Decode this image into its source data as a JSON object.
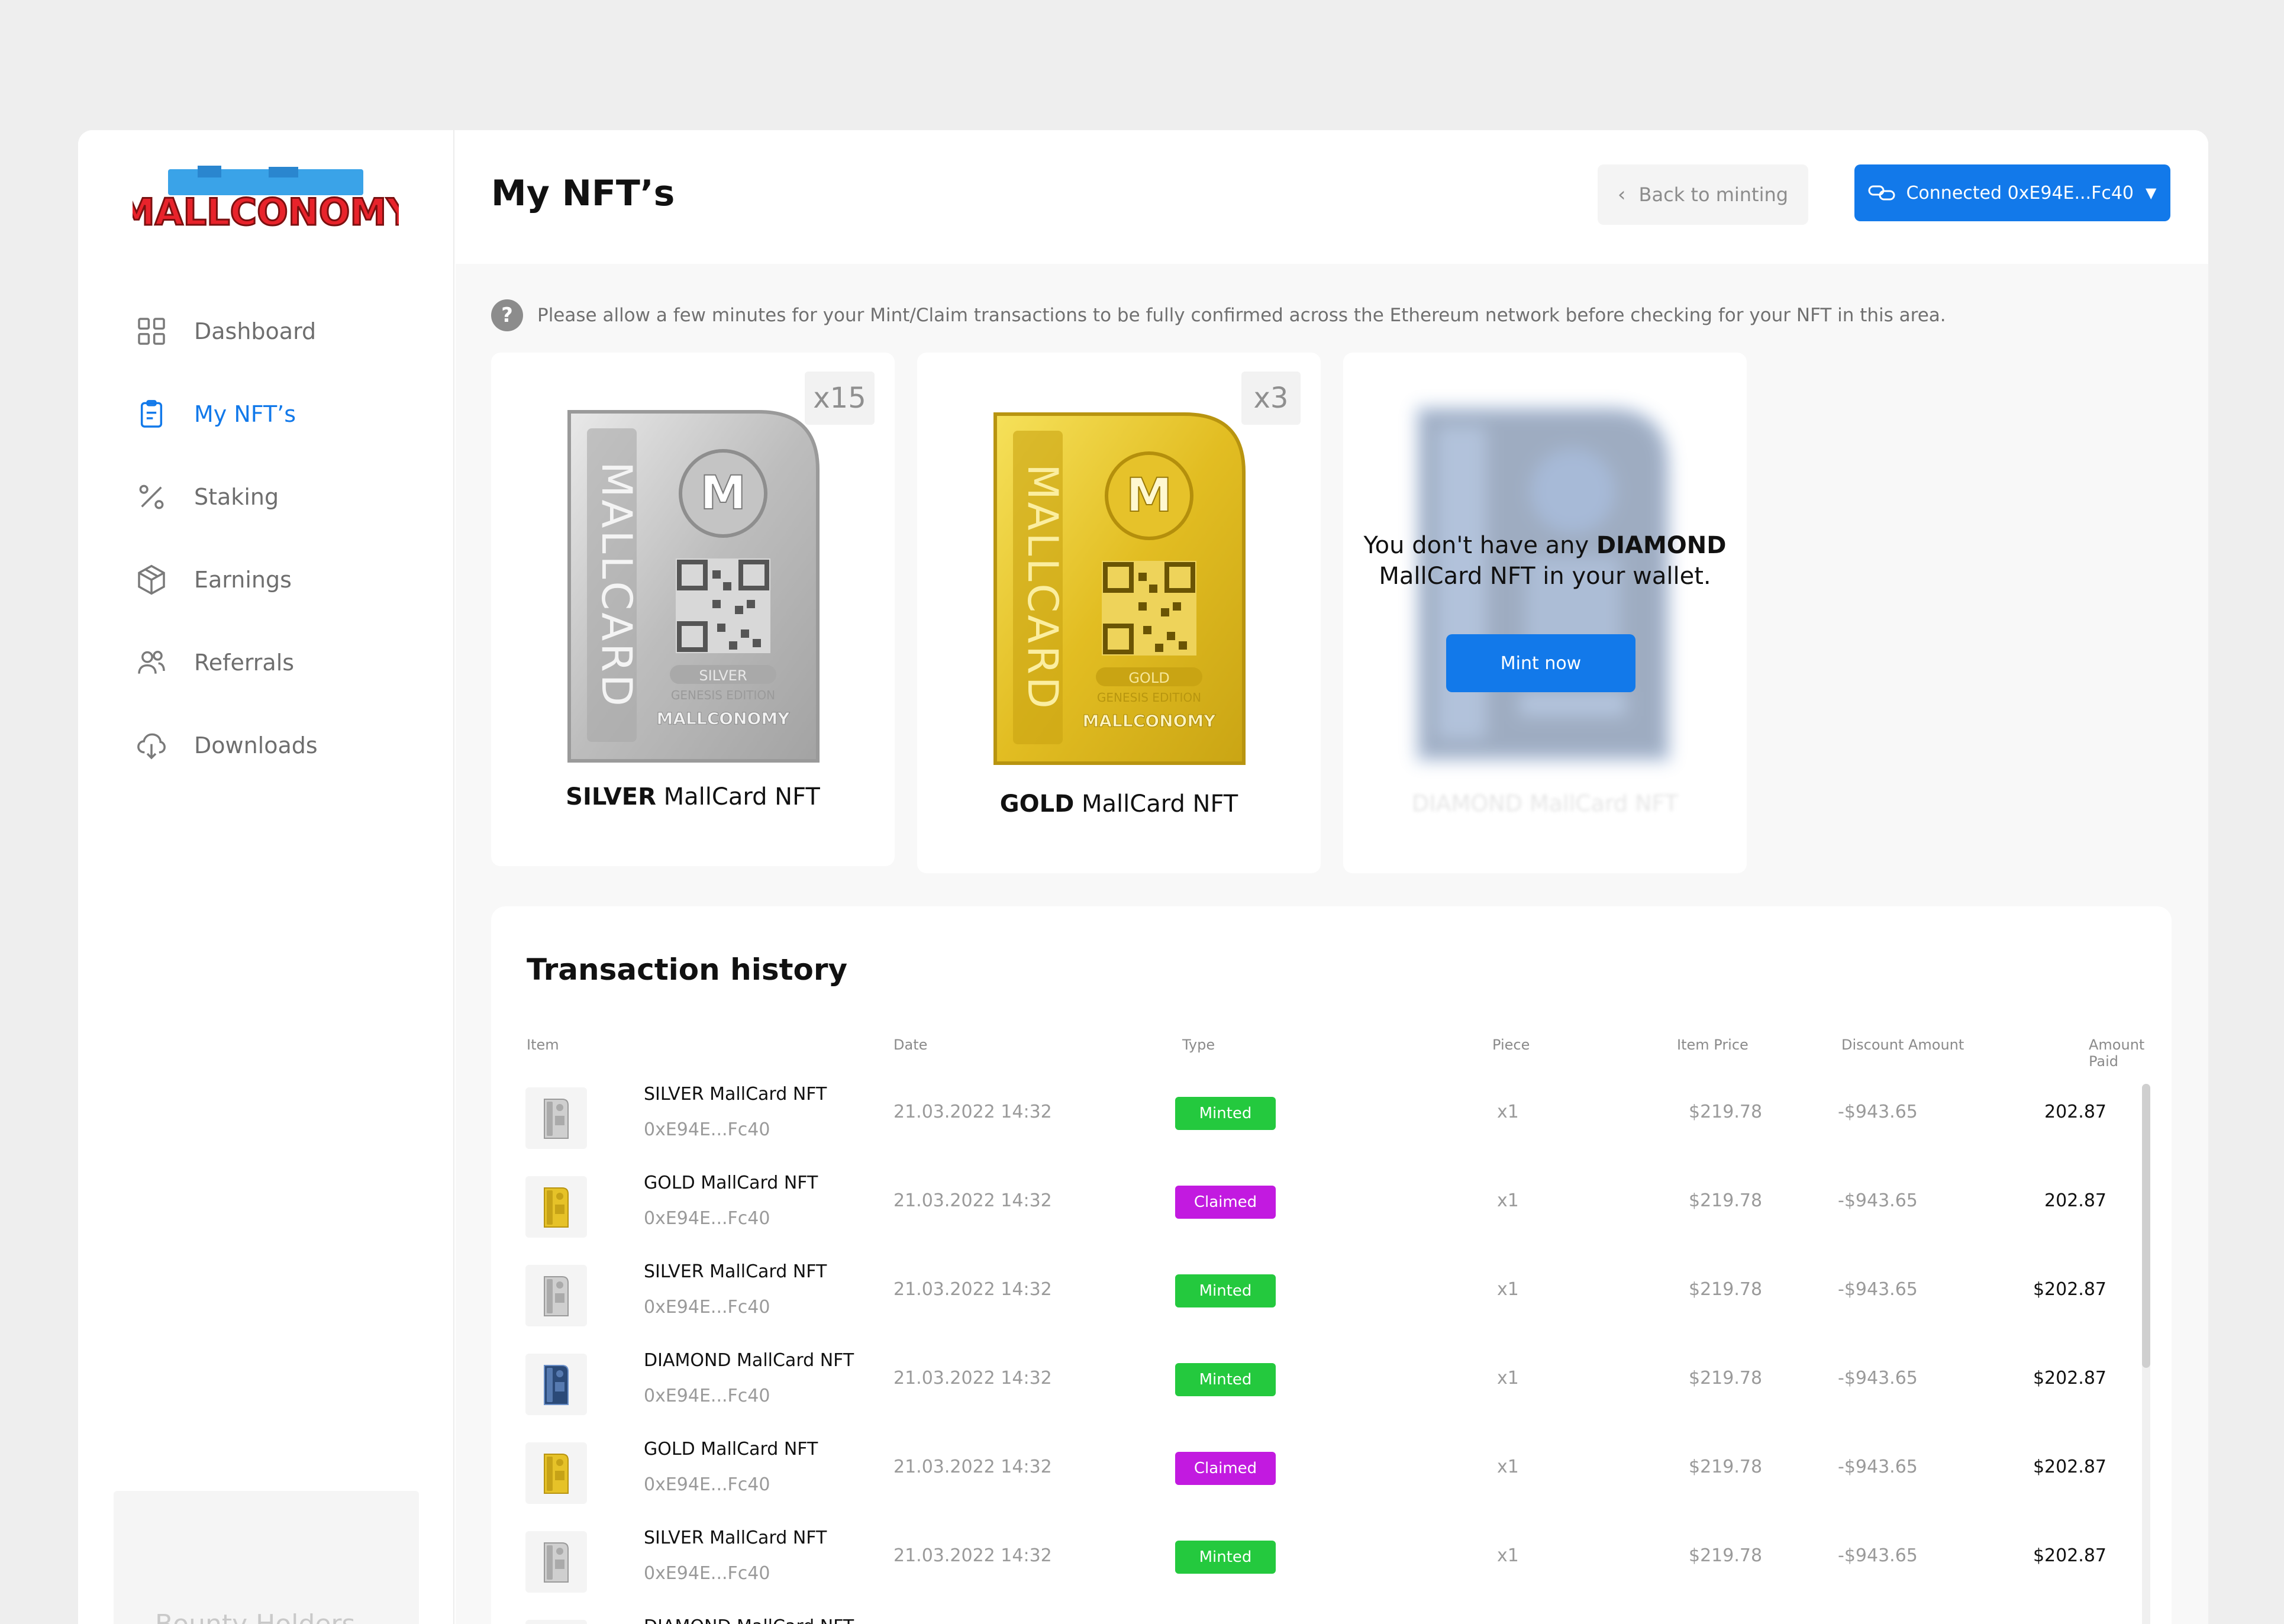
{
  "brand": {
    "logo_text": "MALLCONOMY"
  },
  "sidebar": {
    "items": [
      {
        "label": "Dashboard",
        "icon": "grid-icon",
        "active": false
      },
      {
        "label": "My NFT’s",
        "icon": "clipboard-icon",
        "active": true
      },
      {
        "label": "Staking",
        "icon": "percent-icon",
        "active": false
      },
      {
        "label": "Earnings",
        "icon": "box-icon",
        "active": false
      },
      {
        "label": "Referrals",
        "icon": "users-icon",
        "active": false
      },
      {
        "label": "Downloads",
        "icon": "cloud-download-icon",
        "active": false
      }
    ],
    "promo_text": "Bounty Holders"
  },
  "header": {
    "title": "My NFT’s",
    "back_label": "Back to minting",
    "wallet_label": "Connected 0xE94E...Fc40"
  },
  "notice": {
    "icon": "question-icon",
    "text": "Please allow a few minutes for your Mint/Claim transactions to be fully confirmed across the Ethereum network before checking for your NFT in this area."
  },
  "cards": [
    {
      "tier": "SILVER",
      "suffix": "MallCard NFT",
      "count": "x15",
      "art_vertical": "MALLCARD",
      "art_tier": "SILVER",
      "art_edition": "GENESIS EDITION",
      "art_brand": "MALLCONOMY",
      "color": "#c9c9c9"
    },
    {
      "tier": "GOLD",
      "suffix": "MallCard NFT",
      "count": "x3",
      "art_vertical": "MALLCARD",
      "art_tier": "GOLD",
      "art_edition": "GENESIS EDITION",
      "art_brand": "MALLCONOMY",
      "color": "#e6c228"
    },
    {
      "tier": "DIAMOND",
      "suffix": "MallCard NFT",
      "empty_line1_a": "You don't have any ",
      "empty_line1_b": "DIAMOND",
      "empty_line2": "MallCard NFT in your wallet.",
      "mint_label": "Mint now",
      "blurred_name": "DIAMOND MallCard NFT",
      "color": "#5b7fb0"
    }
  ],
  "history": {
    "title": "Transaction history",
    "columns": [
      "Item",
      "Date",
      "Type",
      "Piece",
      "Item Price",
      "Discount Amount",
      "Amount Paid"
    ],
    "rows": [
      {
        "item": "SILVER MallCard NFT",
        "address": "0xE94E...Fc40",
        "date": "21.03.2022 14:32",
        "type": "Minted",
        "piece": "x1",
        "price": "$219.78",
        "discount": "-$943.65",
        "paid": "202.87",
        "tier": "silver"
      },
      {
        "item": "GOLD MallCard NFT",
        "address": "0xE94E...Fc40",
        "date": "21.03.2022 14:32",
        "type": "Claimed",
        "piece": "x1",
        "price": "$219.78",
        "discount": "-$943.65",
        "paid": "202.87",
        "tier": "gold"
      },
      {
        "item": "SILVER MallCard NFT",
        "address": "0xE94E...Fc40",
        "date": "21.03.2022 14:32",
        "type": "Minted",
        "piece": "x1",
        "price": "$219.78",
        "discount": "-$943.65",
        "paid": "$202.87",
        "tier": "silver"
      },
      {
        "item": "DIAMOND MallCard NFT",
        "address": "0xE94E...Fc40",
        "date": "21.03.2022 14:32",
        "type": "Minted",
        "piece": "x1",
        "price": "$219.78",
        "discount": "-$943.65",
        "paid": "$202.87",
        "tier": "diamond"
      },
      {
        "item": "GOLD MallCard NFT",
        "address": "0xE94E...Fc40",
        "date": "21.03.2022 14:32",
        "type": "Claimed",
        "piece": "x1",
        "price": "$219.78",
        "discount": "-$943.65",
        "paid": "$202.87",
        "tier": "gold"
      },
      {
        "item": "SILVER MallCard NFT",
        "address": "0xE94E...Fc40",
        "date": "21.03.2022 14:32",
        "type": "Minted",
        "piece": "x1",
        "price": "$219.78",
        "discount": "-$943.65",
        "paid": "$202.87",
        "tier": "silver"
      },
      {
        "item": "DIAMOND MallCard NFT",
        "address": "",
        "date": "",
        "type": "",
        "piece": "",
        "price": "",
        "discount": "",
        "paid": "",
        "tier": "diamond"
      }
    ]
  },
  "colors": {
    "accent": "#1279ea",
    "minted": "#24c93e",
    "claimed": "#c21ae0",
    "silver": "#c9c9c9",
    "gold": "#e6c228",
    "diamond": "#2b4a78"
  }
}
